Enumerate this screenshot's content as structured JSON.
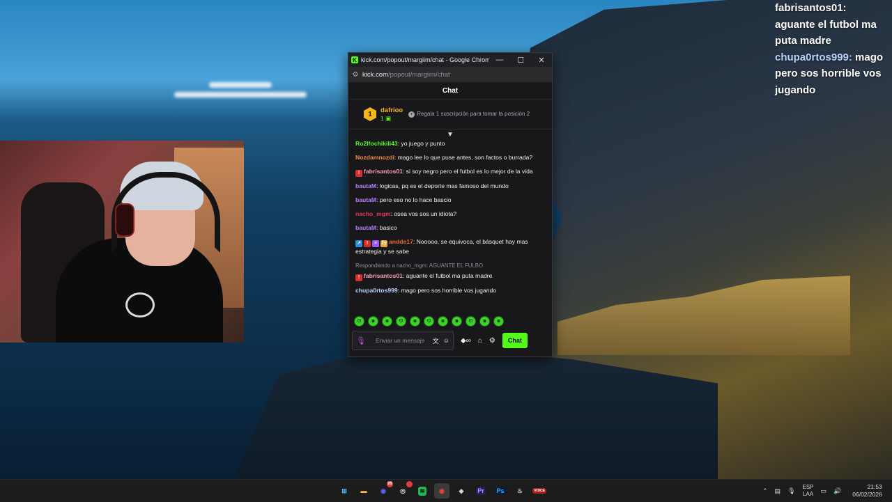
{
  "overlay_chat": [
    {
      "user": "",
      "text": "fabrisantos01:"
    },
    {
      "user": "",
      "text": "aguante el futbol ma"
    },
    {
      "user": "",
      "text": "puta madre"
    },
    {
      "user": "chupa0rtos999:",
      "text": " mago"
    },
    {
      "user": "",
      "text": "pero sos horrible vos"
    },
    {
      "user": "",
      "text": "jugando"
    }
  ],
  "browser": {
    "title": "kick.com/popout/margiim/chat - Google Chrome",
    "url_domain": "kick.com",
    "url_path": "/popout/margiim/chat",
    "minimize": "—",
    "maximize": "☐",
    "close": "✕"
  },
  "chat": {
    "header": "Chat",
    "pinned": {
      "rank": "1",
      "user": "dafrioo",
      "count": "1",
      "gift_text": "Regala 1 suscripción para tomar la posición 2"
    },
    "messages": [
      {
        "user": "Ro2lfochikili43",
        "color": "#53fc18",
        "text": ": yo juego y punto",
        "badges": []
      },
      {
        "user": "Nozdamnozdi",
        "color": "#f08a3c",
        "text": ": mago lee lo que puse antes, son factos o burrada?",
        "badges": []
      },
      {
        "user": "fabrisantos01",
        "color": "#ff9bb0",
        "text": ": si soy negro pero el futbol es lo mejor de la vida",
        "badges": [
          {
            "bg": "#d32f2f",
            "glyph": "!"
          }
        ]
      },
      {
        "user": "bautaM",
        "color": "#b67cff",
        "text": ": logicas, pq es el deporte mas famoso del mundo",
        "badges": []
      },
      {
        "user": "bautaM",
        "color": "#b67cff",
        "text": ": pero eso no lo hace bascio",
        "badges": []
      },
      {
        "user": "nacho_mgm",
        "color": "#e0325a",
        "text": ": osea vos sos un idiota?",
        "badges": []
      },
      {
        "user": "bautaM",
        "color": "#b67cff",
        "text": ": basico",
        "badges": []
      },
      {
        "user": "andde17",
        "color": "#e66b2a",
        "text": ": Nooooo, se equivoca, el básquet hay mas estrategia y se sabe",
        "badges": [
          {
            "bg": "#2a8fd8",
            "glyph": "↗"
          },
          {
            "bg": "#d32f2f",
            "glyph": "!"
          },
          {
            "bg": "#9b59ff",
            "glyph": "≡"
          },
          {
            "bg": "#e6a23c",
            "glyph": "2y"
          }
        ]
      },
      {
        "reply": "Respondiendo a nacho_mgm: AGUANTE EL FULBO",
        "user": "fabrisantos01",
        "color": "#ff9bb0",
        "text": ": aguante el futbol ma puta madre",
        "badges": [
          {
            "bg": "#d32f2f",
            "glyph": "!"
          }
        ]
      },
      {
        "user": "chupa0rtos999",
        "color": "#b9d3ff",
        "text": ": mago pero sos horrible vos jugando",
        "badges": []
      }
    ],
    "emotes": [
      "ʘ",
      "☻",
      "☻",
      "ʘ",
      "☻",
      "ʘ",
      "☻",
      "☻",
      "ʘ",
      "☻",
      "☻"
    ],
    "input_placeholder": "Enviar un mensaje",
    "send_label": "Chat"
  },
  "taskbar": {
    "icons": [
      {
        "name": "windows-start-icon",
        "glyph": "⊞",
        "bg": "transparent",
        "color": "#4cc2ff"
      },
      {
        "name": "file-explorer-icon",
        "glyph": "▬",
        "bg": "transparent",
        "color": "#f6c343"
      },
      {
        "name": "discord-icon",
        "glyph": "◉",
        "bg": "transparent",
        "color": "#5865f2",
        "notif": "99"
      },
      {
        "name": "obs-icon",
        "glyph": "◎",
        "bg": "transparent",
        "color": "#dddddd",
        "notif": ""
      },
      {
        "name": "spotify-icon",
        "glyph": "≋",
        "bg": "#1db954",
        "color": "#000000"
      },
      {
        "name": "chrome-icon",
        "glyph": "◉",
        "bg": "transparent",
        "color": "#ea4335",
        "active": true
      },
      {
        "name": "app-icon",
        "glyph": "◈",
        "bg": "transparent",
        "color": "#dddddd"
      },
      {
        "name": "premiere-icon",
        "glyph": "Pr",
        "bg": "#2a1a55",
        "color": "#9999ff"
      },
      {
        "name": "photoshop-icon",
        "glyph": "Ps",
        "bg": "#0a1e33",
        "color": "#31a8ff"
      },
      {
        "name": "steam-icon",
        "glyph": "♨",
        "bg": "transparent",
        "color": "#c7d5e0"
      },
      {
        "name": "voicemod-icon",
        "glyph": "VOICE",
        "bg": "#b01c1c",
        "color": "#ffffff"
      }
    ],
    "lang_top": "ESP",
    "lang_bottom": "LAA",
    "time": "21:53",
    "date": "06/02/2026"
  }
}
